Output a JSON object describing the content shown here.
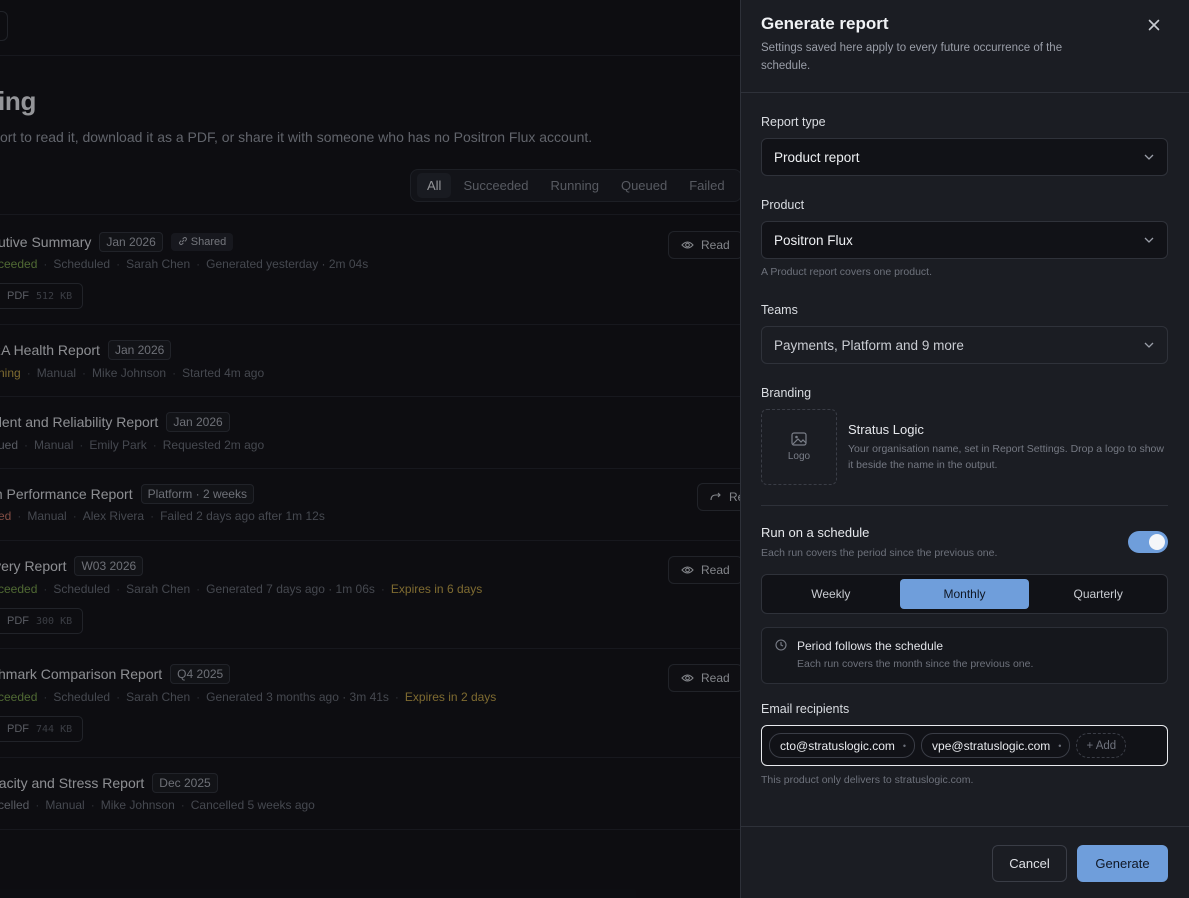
{
  "background": {
    "heading": "ing",
    "subtitle": "ort to read it, download it as a PDF, or share it with someone who has no Positron Flux account.",
    "filters": [
      "All",
      "Succeeded",
      "Running",
      "Queued",
      "Failed"
    ],
    "rows": [
      {
        "title": "cutive Summary",
        "tag": "Jan 2026",
        "shared": "Shared",
        "status": "ceeded",
        "trigger": "Scheduled",
        "owner": "Sarah Chen",
        "detail": "Generated yesterday · 2m 04s",
        "expires": "",
        "file": "PDF",
        "size": "512 KB",
        "action": "Read"
      },
      {
        "title": "RA Health Report",
        "tag": "Jan 2026",
        "status": "ning",
        "trigger": "Manual",
        "owner": "Mike Johnson",
        "detail": "Started 4m ago"
      },
      {
        "title": "ident and Reliability Report",
        "tag": "Jan 2026",
        "status": "ued",
        "trigger": "Manual",
        "owner": "Emily Park",
        "detail": "Requested 2m ago"
      },
      {
        "title": "m Performance Report",
        "tag": "Platform · 2 weeks",
        "status": "ed",
        "trigger": "Manual",
        "owner": "Alex Rivera",
        "detail": "Failed 2 days ago after 1m 12s",
        "action": "Re"
      },
      {
        "title": "ivery Report",
        "tag": "W03 2026",
        "status": "ceeded",
        "trigger": "Scheduled",
        "owner": "Sarah Chen",
        "detail": "Generated 7 days ago · 1m 06s",
        "expires": "Expires in 6 days",
        "file": "PDF",
        "size": "300 KB",
        "action": "Read"
      },
      {
        "title": "chmark Comparison Report",
        "tag": "Q4 2025",
        "status": "ceeded",
        "trigger": "Scheduled",
        "owner": "Sarah Chen",
        "detail": "Generated 3 months ago · 3m 41s",
        "expires": "Expires in 2 days",
        "file": "PDF",
        "size": "744 KB",
        "action": "Read"
      },
      {
        "title": "pacity and Stress Report",
        "tag": "Dec 2025",
        "status": "celled",
        "trigger": "Manual",
        "owner": "Mike Johnson",
        "detail": "Cancelled 5 weeks ago"
      }
    ]
  },
  "drawer": {
    "title": "Generate report",
    "description": "Settings saved here apply to every future occurrence of the schedule.",
    "report_type": {
      "label": "Report type",
      "value": "Product report"
    },
    "product": {
      "label": "Product",
      "value": "Positron Flux",
      "hint": "A Product report covers one product."
    },
    "teams": {
      "label": "Teams",
      "value": "Payments, Platform and 9 more"
    },
    "branding": {
      "label": "Branding",
      "logo_label": "Logo",
      "org_name": "Stratus Logic",
      "org_desc": "Your organisation name, set in Report Settings. Drop a logo to show it beside the name in the output."
    },
    "schedule": {
      "title": "Run on a schedule",
      "desc": "Each run covers the period since the previous one.",
      "enabled": true,
      "options": [
        "Weekly",
        "Monthly",
        "Quarterly"
      ],
      "selected": "Monthly"
    },
    "period": {
      "title": "Period follows the schedule",
      "desc": "Each run covers the month since the previous one."
    },
    "recipients": {
      "label": "Email recipients",
      "emails": [
        "cto@stratuslogic.com",
        "vpe@stratuslogic.com"
      ],
      "add_label": "+ Add",
      "hint": "This product only delivers to stratuslogic.com."
    },
    "footer": {
      "cancel": "Cancel",
      "generate": "Generate"
    }
  },
  "colors": {
    "accent": "#6f9edb",
    "success": "#7ea74e",
    "warning": "#c9a94a",
    "danger": "#d07a6a"
  }
}
